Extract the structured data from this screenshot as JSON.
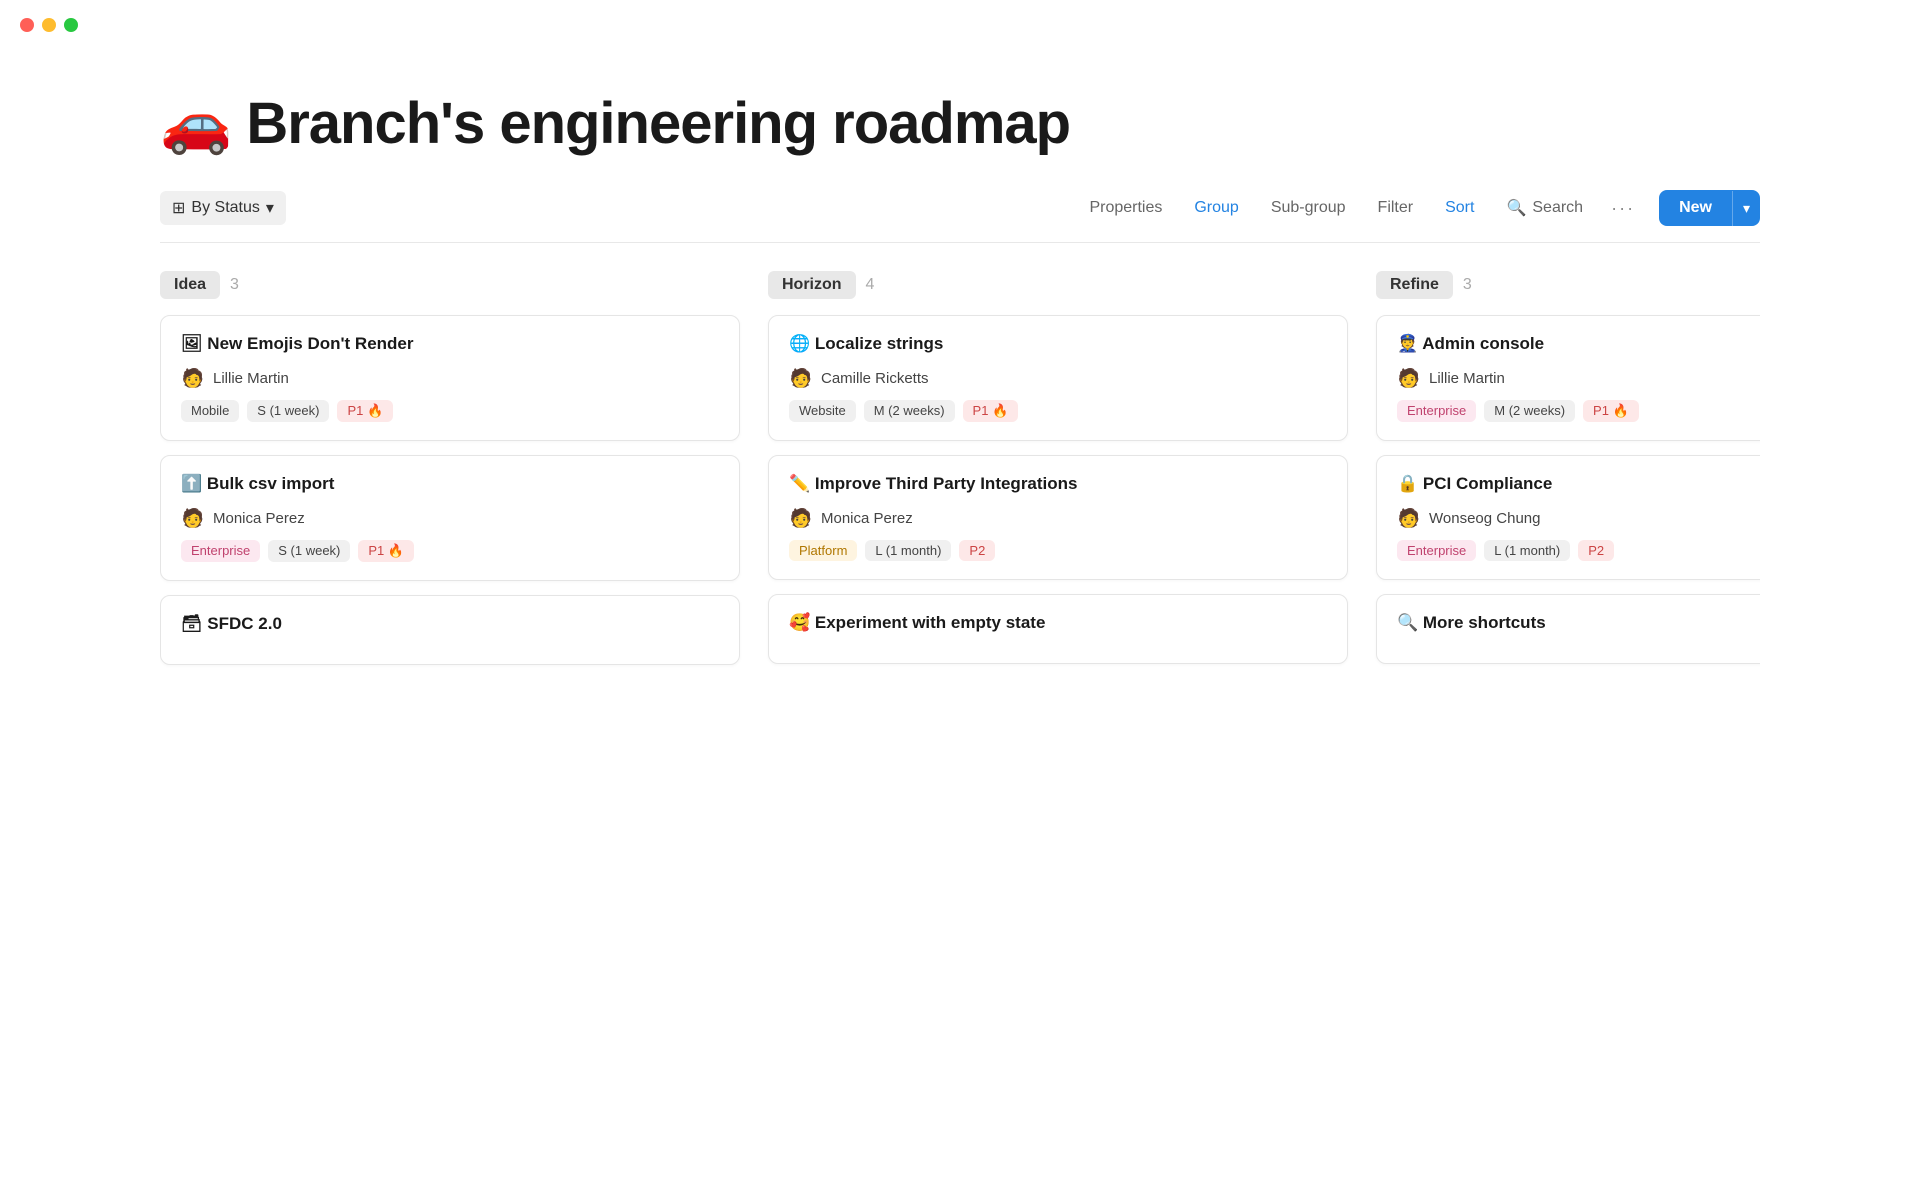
{
  "window": {
    "traffic_lights": [
      "red",
      "yellow",
      "green"
    ]
  },
  "page": {
    "title": "🚗 Branch's engineering roadmap"
  },
  "toolbar": {
    "group_by_label": "By Status",
    "group_by_icon": "⊞",
    "chevron": "▾",
    "properties_label": "Properties",
    "group_label": "Group",
    "subgroup_label": "Sub-group",
    "filter_label": "Filter",
    "sort_label": "Sort",
    "search_label": "Search",
    "more_label": "···",
    "new_label": "New",
    "new_chevron": "▾"
  },
  "columns": [
    {
      "id": "idea",
      "label": "Idea",
      "count": 3,
      "cards": [
        {
          "title": "🖼 New Emojis Don't Render",
          "person": "Lillie Martin",
          "avatar": "🧑",
          "tags": [
            {
              "label": "Mobile",
              "type": "mobile"
            },
            {
              "label": "S (1 week)",
              "type": "size"
            },
            {
              "label": "P1 🔥",
              "type": "p1"
            }
          ]
        },
        {
          "title": "⬆️ Bulk csv import",
          "person": "Monica Perez",
          "avatar": "🧑",
          "tags": [
            {
              "label": "Enterprise",
              "type": "enterprise"
            },
            {
              "label": "S (1 week)",
              "type": "size"
            },
            {
              "label": "P1 🔥",
              "type": "p1"
            }
          ]
        },
        {
          "title": "🗃 SFDC 2.0",
          "partial": true
        }
      ]
    },
    {
      "id": "horizon",
      "label": "Horizon",
      "count": 4,
      "cards": [
        {
          "title": "🌐 Localize strings",
          "person": "Camille Ricketts",
          "avatar": "🧑",
          "tags": [
            {
              "label": "Website",
              "type": "website"
            },
            {
              "label": "M (2 weeks)",
              "type": "size"
            },
            {
              "label": "P1 🔥",
              "type": "p1"
            }
          ]
        },
        {
          "title": "✏️ Improve Third Party Integrations",
          "person": "Monica Perez",
          "avatar": "🧑",
          "tags": [
            {
              "label": "Platform",
              "type": "platform"
            },
            {
              "label": "L (1 month)",
              "type": "size"
            },
            {
              "label": "P2",
              "type": "p2"
            }
          ]
        },
        {
          "title": "🥰 Experiment with empty state",
          "partial": true
        }
      ]
    },
    {
      "id": "refine",
      "label": "Refine",
      "count": 3,
      "cards": [
        {
          "title": "👮 Admin console",
          "person": "Lillie Martin",
          "avatar": "🧑",
          "tags": [
            {
              "label": "Enterprise",
              "type": "enterprise"
            },
            {
              "label": "M (2 weeks)",
              "type": "size"
            },
            {
              "label": "P1 🔥",
              "type": "p1"
            }
          ]
        },
        {
          "title": "🔒 PCI Compliance",
          "person": "Wonseog Chung",
          "avatar": "🧑",
          "tags": [
            {
              "label": "Enterprise",
              "type": "enterprise"
            },
            {
              "label": "L (1 month)",
              "type": "size"
            },
            {
              "label": "P2",
              "type": "p2"
            }
          ]
        },
        {
          "title": "🔍 More shortcuts",
          "partial": true
        }
      ]
    }
  ]
}
